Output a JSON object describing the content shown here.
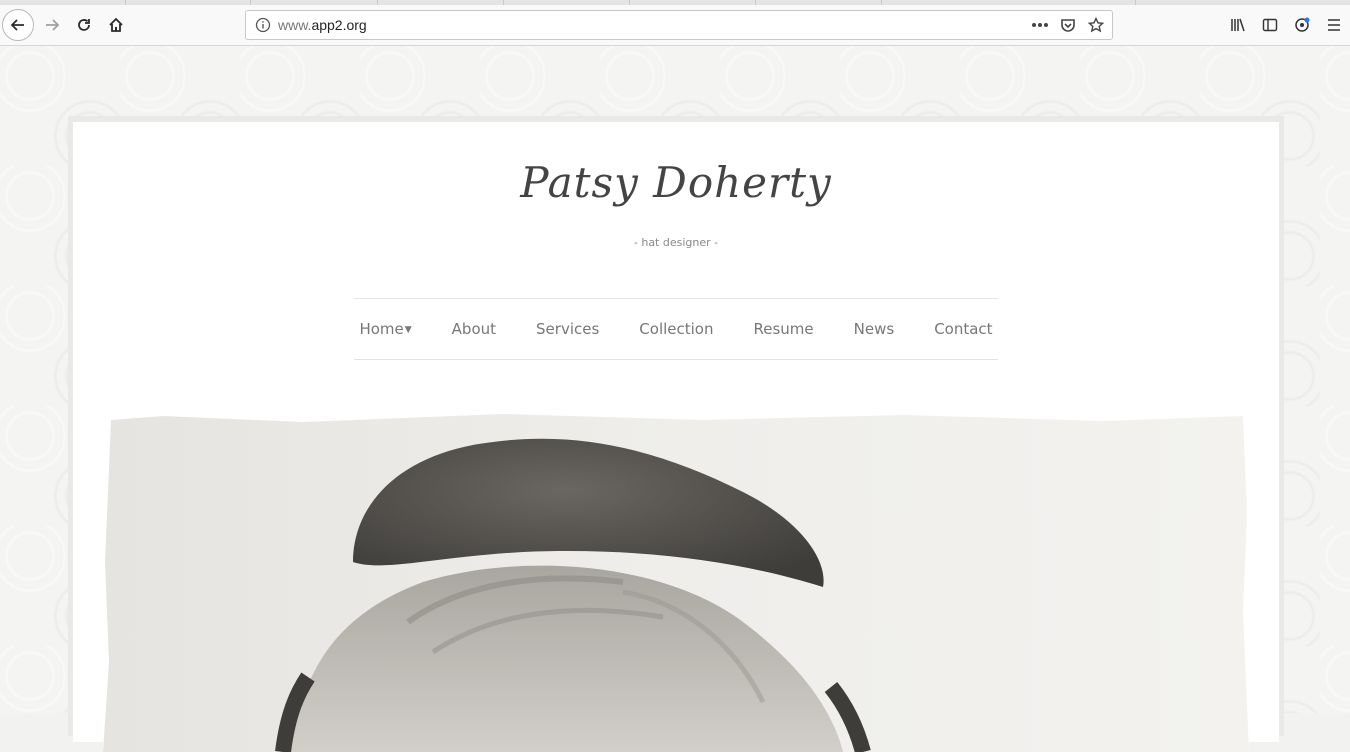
{
  "browser": {
    "url_prefix": "www.",
    "url_domain": "app2.org"
  },
  "site": {
    "title": "Patsy Doherty",
    "tagline": "- hat designer -"
  },
  "nav": {
    "items": [
      {
        "label": "Home",
        "has_dropdown": true
      },
      {
        "label": "About"
      },
      {
        "label": "Services"
      },
      {
        "label": "Collection"
      },
      {
        "label": "Resume"
      },
      {
        "label": "News"
      },
      {
        "label": "Contact"
      }
    ]
  },
  "colors": {
    "title": "#444444",
    "nav_text": "#777777",
    "tagline": "#8a8a8a"
  }
}
